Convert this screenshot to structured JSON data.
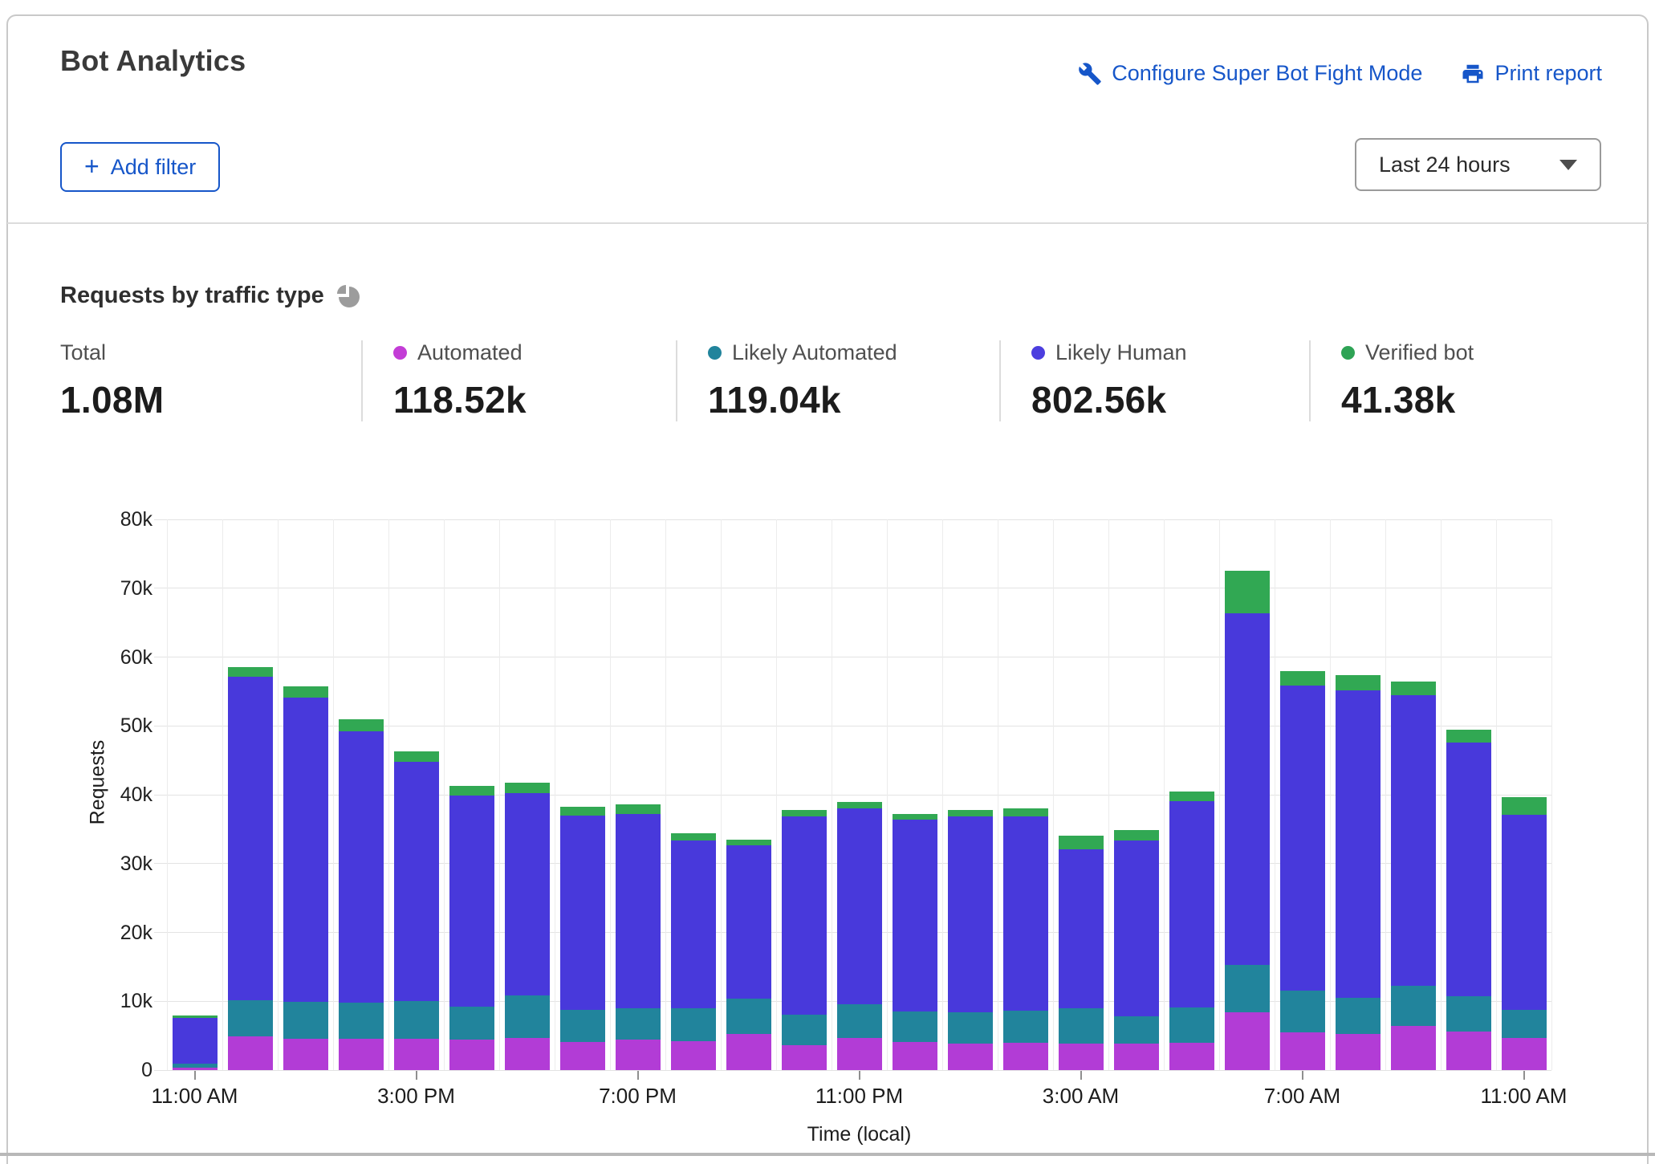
{
  "header": {
    "title": "Bot Analytics",
    "configure_link": "Configure Super Bot Fight Mode",
    "print_link": "Print report",
    "add_filter_label": "Add filter",
    "time_range": "Last 24 hours"
  },
  "section": {
    "title": "Requests by traffic type"
  },
  "stats": [
    {
      "label": "Total",
      "value": "1.08M",
      "color": null
    },
    {
      "label": "Automated",
      "value": "118.52k",
      "color": "#c33dd6"
    },
    {
      "label": "Likely Automated",
      "value": "119.04k",
      "color": "#21849c"
    },
    {
      "label": "Likely Human",
      "value": "802.56k",
      "color": "#4c3edf"
    },
    {
      "label": "Verified bot",
      "value": "41.38k",
      "color": "#2ea355"
    }
  ],
  "colors": {
    "link_blue": "#1656c9",
    "automated": "#b23cd6",
    "likely_automated": "#21849c",
    "likely_human": "#4839db",
    "verified_bot": "#31a853"
  },
  "chart_data": {
    "type": "bar",
    "stacked": true,
    "title": "Requests by traffic type",
    "xlabel": "Time (local)",
    "ylabel": "Requests",
    "ylim": [
      0,
      80000
    ],
    "grid": true,
    "values_unit": "thousands of requests per hour",
    "bars_count": 25,
    "y_tick_labels": [
      "0",
      "10k",
      "20k",
      "30k",
      "40k",
      "50k",
      "60k",
      "70k",
      "80k"
    ],
    "x_tick_positions": [
      0,
      4,
      8,
      12,
      16,
      20,
      24
    ],
    "x_tick_labels": [
      "11:00 AM",
      "3:00 PM",
      "7:00 PM",
      "11:00 PM",
      "3:00 AM",
      "7:00 AM",
      "11:00 AM"
    ],
    "series": [
      {
        "name": "Automated",
        "color": "#b23cd6",
        "values": [
          0.4,
          4.9,
          4.5,
          4.5,
          4.6,
          4.4,
          4.7,
          4.1,
          4.4,
          4.2,
          5.2,
          3.6,
          4.7,
          4.1,
          3.9,
          4.0,
          3.8,
          3.8,
          4.0,
          8.4,
          5.5,
          5.2,
          6.4,
          5.6,
          4.7
        ]
      },
      {
        "name": "Likely Automated",
        "color": "#21849c",
        "values": [
          0.5,
          5.3,
          5.4,
          5.3,
          5.4,
          4.8,
          6.1,
          4.7,
          4.6,
          4.8,
          5.2,
          4.4,
          4.9,
          4.4,
          4.5,
          4.6,
          5.2,
          4.0,
          5.1,
          6.9,
          6.1,
          5.3,
          5.8,
          5.1,
          4.0
        ]
      },
      {
        "name": "Likely Human",
        "color": "#4839db",
        "values": [
          6.7,
          47.0,
          44.2,
          39.4,
          34.8,
          30.7,
          29.4,
          28.2,
          28.2,
          24.4,
          22.2,
          28.9,
          28.4,
          27.9,
          28.5,
          28.2,
          23.1,
          25.6,
          30.0,
          51.1,
          44.3,
          44.7,
          42.3,
          36.9,
          28.4
        ]
      },
      {
        "name": "Verified bot",
        "color": "#31a853",
        "values": [
          0.3,
          1.3,
          1.6,
          1.8,
          1.5,
          1.4,
          1.6,
          1.3,
          1.4,
          1.0,
          0.9,
          0.9,
          0.9,
          0.8,
          0.9,
          1.2,
          2.0,
          1.5,
          1.4,
          6.1,
          2.1,
          2.2,
          1.9,
          1.8,
          2.5
        ]
      }
    ]
  }
}
